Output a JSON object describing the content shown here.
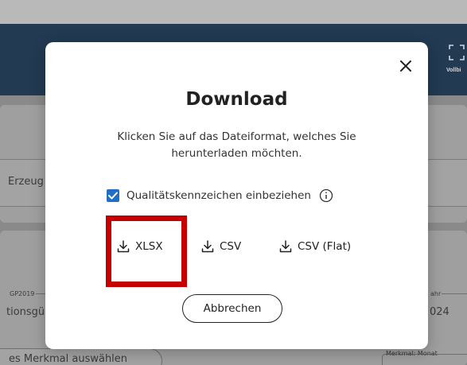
{
  "background": {
    "fullscreen_label": "Vollbi",
    "field_left_text": "Erzeug",
    "label_gp": "GP2019",
    "field_text_left": "tionsgü",
    "label_right": "ahr",
    "field_text_right": "024",
    "merkmal_label": "Merkmal: Monat",
    "select_pill_text": "es Merkmal auswählen"
  },
  "modal": {
    "title": "Download",
    "description": "Klicken Sie auf das Dateiformat, welches Sie herunterladen möchten.",
    "quality_checkbox": {
      "label": "Qualitätskennzeichen einbeziehen",
      "checked": true
    },
    "formats": [
      {
        "label": "XLSX",
        "icon": "download-icon"
      },
      {
        "label": "CSV",
        "icon": "download-icon"
      },
      {
        "label": "CSV (Flat)",
        "icon": "download-icon"
      }
    ],
    "cancel_label": "Abbrechen",
    "close_icon": "close-icon",
    "info_icon": "info-icon"
  },
  "colors": {
    "header": "#223a52",
    "checkbox": "#1f6fc5",
    "highlight": "#c40000"
  }
}
